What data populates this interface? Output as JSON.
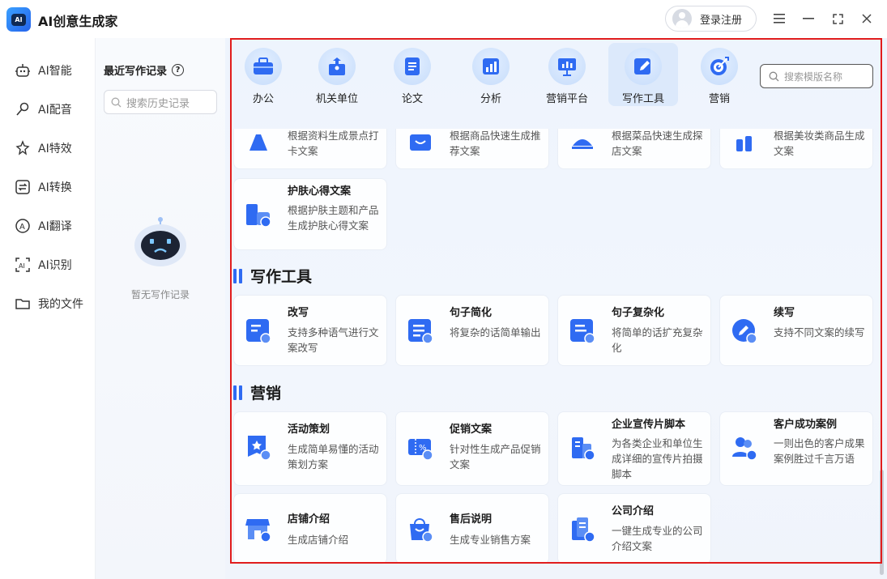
{
  "app": {
    "title": "AI创意生成家",
    "logo_text": "AI",
    "login_label": "登录注册"
  },
  "window": {
    "menu_icon": "hamburger-icon",
    "min_icon": "minimize-icon",
    "max_icon": "maximize-icon",
    "close_icon": "close-icon"
  },
  "nav": {
    "items": [
      {
        "label": "AI智能",
        "icon": "robot-icon"
      },
      {
        "label": "AI配音",
        "icon": "microphone-icon"
      },
      {
        "label": "AI特效",
        "icon": "sparkle-icon"
      },
      {
        "label": "AI转换",
        "icon": "convert-icon"
      },
      {
        "label": "AI翻译",
        "icon": "translate-icon"
      },
      {
        "label": "AI识别",
        "icon": "scan-icon"
      },
      {
        "label": "我的文件",
        "icon": "folder-icon"
      }
    ]
  },
  "history": {
    "title": "最近写作记录",
    "search_placeholder": "搜索历史记录",
    "empty_text": "暂无写作记录"
  },
  "categories": [
    {
      "label": "办公",
      "icon": "briefcase-icon"
    },
    {
      "label": "机关单位",
      "icon": "building-icon"
    },
    {
      "label": "论文",
      "icon": "document-icon"
    },
    {
      "label": "分析",
      "icon": "chart-icon"
    },
    {
      "label": "营销平台",
      "icon": "presentation-icon"
    },
    {
      "label": "写作工具",
      "icon": "pen-icon",
      "active": true
    },
    {
      "label": "营销",
      "icon": "target-icon"
    }
  ],
  "template_search_placeholder": "搜索模版名称",
  "top_partial_cards": [
    {
      "desc": "根据资料生成景点打卡文案"
    },
    {
      "desc": "根据商品快速生成推荐文案"
    },
    {
      "desc": "根据菜品快速生成探店文案"
    },
    {
      "desc": "根据美妆类商品生成文案"
    }
  ],
  "skincare_card": {
    "title": "护肤心得文案",
    "desc": "根据护肤主题和产品生成护肤心得文案"
  },
  "writing_section": {
    "title": "写作工具",
    "cards": [
      {
        "title": "改写",
        "desc": "支持多种语气进行文案改写"
      },
      {
        "title": "句子简化",
        "desc": "将复杂的话简单输出"
      },
      {
        "title": "句子复杂化",
        "desc": "将简单的话扩充复杂化"
      },
      {
        "title": "续写",
        "desc": "支持不同文案的续写"
      }
    ]
  },
  "marketing_section": {
    "title": "营销",
    "cards": [
      {
        "title": "活动策划",
        "desc": "生成简单易懂的活动策划方案"
      },
      {
        "title": "促销文案",
        "desc": "针对性生成产品促销文案"
      },
      {
        "title": "企业宣传片脚本",
        "desc": "为各类企业和单位生成详细的宣传片拍摄脚本"
      },
      {
        "title": "客户成功案例",
        "desc": "一则出色的客户成果案例胜过千言万语"
      },
      {
        "title": "店铺介绍",
        "desc": "生成店铺介绍"
      },
      {
        "title": "售后说明",
        "desc": "生成专业销售方案"
      },
      {
        "title": "公司介绍",
        "desc": "一键生成专业的公司介绍文案"
      }
    ]
  },
  "colors": {
    "accent": "#2f6bf2",
    "highlight_frame": "#e11d1d"
  }
}
